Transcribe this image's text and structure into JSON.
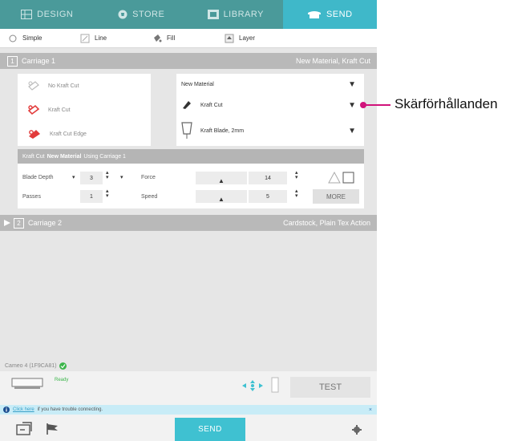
{
  "nav": {
    "tabs": [
      {
        "label": "DESIGN",
        "icon": "design-grid-icon"
      },
      {
        "label": "STORE",
        "icon": "store-icon"
      },
      {
        "label": "LIBRARY",
        "icon": "library-icon"
      },
      {
        "label": "SEND",
        "icon": "send-cutter-icon",
        "active": true
      }
    ]
  },
  "modes": [
    {
      "label": "Simple",
      "icon": "simple-radio-icon"
    },
    {
      "label": "Line",
      "icon": "line-icon"
    },
    {
      "label": "Fill",
      "icon": "fill-icon"
    },
    {
      "label": "Layer",
      "icon": "layer-icon"
    }
  ],
  "carriage1": {
    "number": "1",
    "name": "Carriage 1",
    "summary": "New Material, Kraft Cut",
    "cut_items": [
      "No Kraft Cut",
      "Kraft Cut",
      "Kraft Cut Edge"
    ],
    "material": "New Material",
    "action": "Kraft Cut",
    "tool": "Kraft Blade, 2mm",
    "material_bar": {
      "prefix": "Kraft Cut",
      "material": "New Material",
      "suffix": "Using Carriage 1"
    },
    "settings": {
      "blade_depth_label": "Blade Depth",
      "blade_depth_value": "3",
      "force_label": "Force",
      "force_value": "14",
      "passes_label": "Passes",
      "passes_value": "1",
      "speed_label": "Speed",
      "speed_value": "5",
      "more_label": "MORE"
    }
  },
  "carriage2": {
    "number": "2",
    "name": "Carriage 2",
    "summary": "Cardstock, Plain Tex Action"
  },
  "device": {
    "status": "Cameo 4 (1F9CA81)",
    "ready_label": "Ready",
    "test_label": "TEST"
  },
  "info": {
    "link": "Click here",
    "text": "if you have trouble connecting.",
    "close": "×"
  },
  "bottom": {
    "send_label": "SEND"
  },
  "callout": {
    "label": "Skärförhållanden"
  },
  "colors": {
    "accent": "#3fc1d1",
    "nav_bg": "#4a9a9a",
    "callout": "#d1137b",
    "cut_red": "#e23b3b"
  }
}
